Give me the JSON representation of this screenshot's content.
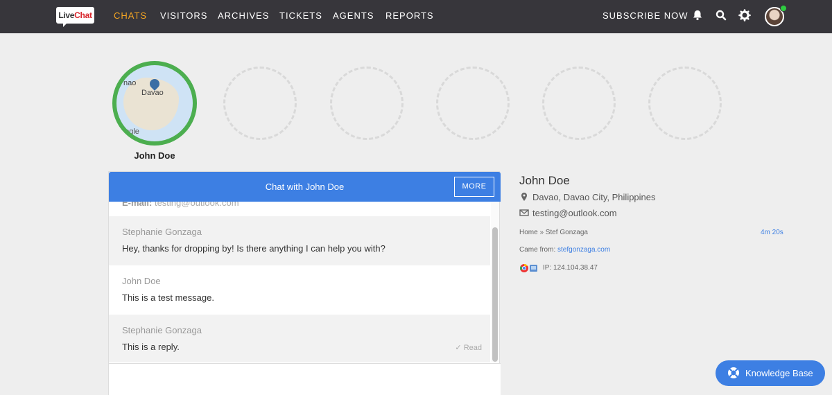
{
  "nav": {
    "logo_live": "Live",
    "logo_chat": "Chat",
    "items": [
      "CHATS",
      "VISITORS",
      "ARCHIVES",
      "TICKETS",
      "AGENTS",
      "REPORTS"
    ],
    "active_item": "CHATS",
    "subscribe": "SUBSCRIBE NOW"
  },
  "visitor": {
    "name": "John Doe",
    "map_label_1": "nao",
    "map_label_2": "Davao",
    "map_attribution": "oogle"
  },
  "chat": {
    "title": "Chat with John Doe",
    "more_label": "MORE",
    "email_label": "E-mail:",
    "email_value": "testing@outlook.com",
    "messages": [
      {
        "author": "Stephanie Gonzaga",
        "text": "Hey, thanks for dropping by! Is there anything I can help you with?",
        "status": ""
      },
      {
        "author": "John Doe",
        "text": "This is a test message.",
        "status": ""
      },
      {
        "author": "Stephanie Gonzaga",
        "text": "This is a reply.",
        "status": "✓ Read"
      }
    ]
  },
  "details": {
    "name": "John Doe",
    "location": "Davao, Davao City, Philippines",
    "email": "testing@outlook.com",
    "breadcrumb": "Home » Stef Gonzaga",
    "duration": "4m 20s",
    "came_from_label": "Came from:",
    "came_from_url": "stefgonzaga.com",
    "ip": "IP: 124.104.38.47"
  },
  "knowledge_base": {
    "label": "Knowledge Base"
  },
  "colors": {
    "accent": "#3d7fe3",
    "nav_bg": "#37363b",
    "active_nav": "#f5a623",
    "online": "#4cae4f"
  }
}
